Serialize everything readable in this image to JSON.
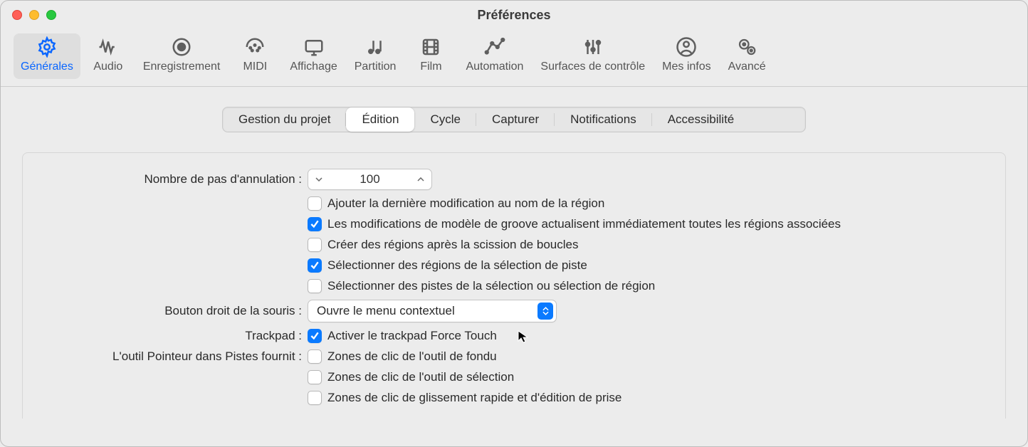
{
  "window": {
    "title": "Préférences"
  },
  "toolbar": {
    "items": [
      {
        "label": "Générales",
        "icon": "gear"
      },
      {
        "label": "Audio",
        "icon": "audio"
      },
      {
        "label": "Enregistrement",
        "icon": "record"
      },
      {
        "label": "MIDI",
        "icon": "midi"
      },
      {
        "label": "Affichage",
        "icon": "display"
      },
      {
        "label": "Partition",
        "icon": "score"
      },
      {
        "label": "Film",
        "icon": "film"
      },
      {
        "label": "Automation",
        "icon": "automation"
      },
      {
        "label": "Surfaces de contrôle",
        "icon": "sliders"
      },
      {
        "label": "Mes infos",
        "icon": "user"
      },
      {
        "label": "Avancé",
        "icon": "advanced"
      }
    ],
    "selected_index": 0
  },
  "subtabs": {
    "items": [
      "Gestion du projet",
      "Édition",
      "Cycle",
      "Capturer",
      "Notifications",
      "Accessibilité"
    ],
    "selected_index": 1
  },
  "form": {
    "undoSteps": {
      "label": "Nombre de pas d'annulation :",
      "value": "100"
    },
    "checkboxes": [
      {
        "label": "Ajouter la dernière modification au nom de la région",
        "checked": false
      },
      {
        "label": "Les modifications de modèle de groove actualisent immédiatement toutes les régions associées",
        "checked": true
      },
      {
        "label": "Créer des régions après la scission de boucles",
        "checked": false
      },
      {
        "label": "Sélectionner des régions de la sélection de piste",
        "checked": true
      },
      {
        "label": "Sélectionner des pistes de la sélection ou sélection de région",
        "checked": false
      }
    ],
    "rightClick": {
      "label": "Bouton droit de la souris :",
      "value": "Ouvre le menu contextuel"
    },
    "trackpad": {
      "label": "Trackpad :",
      "option": "Activer le trackpad Force Touch",
      "checked": true
    },
    "pointerTool": {
      "label": "L'outil Pointeur dans Pistes fournit :",
      "options": [
        {
          "label": "Zones de clic de l'outil de fondu",
          "checked": false
        },
        {
          "label": "Zones de clic de l'outil de sélection",
          "checked": false
        },
        {
          "label": "Zones de clic de glissement rapide et d'édition de prise",
          "checked": false
        }
      ]
    }
  }
}
